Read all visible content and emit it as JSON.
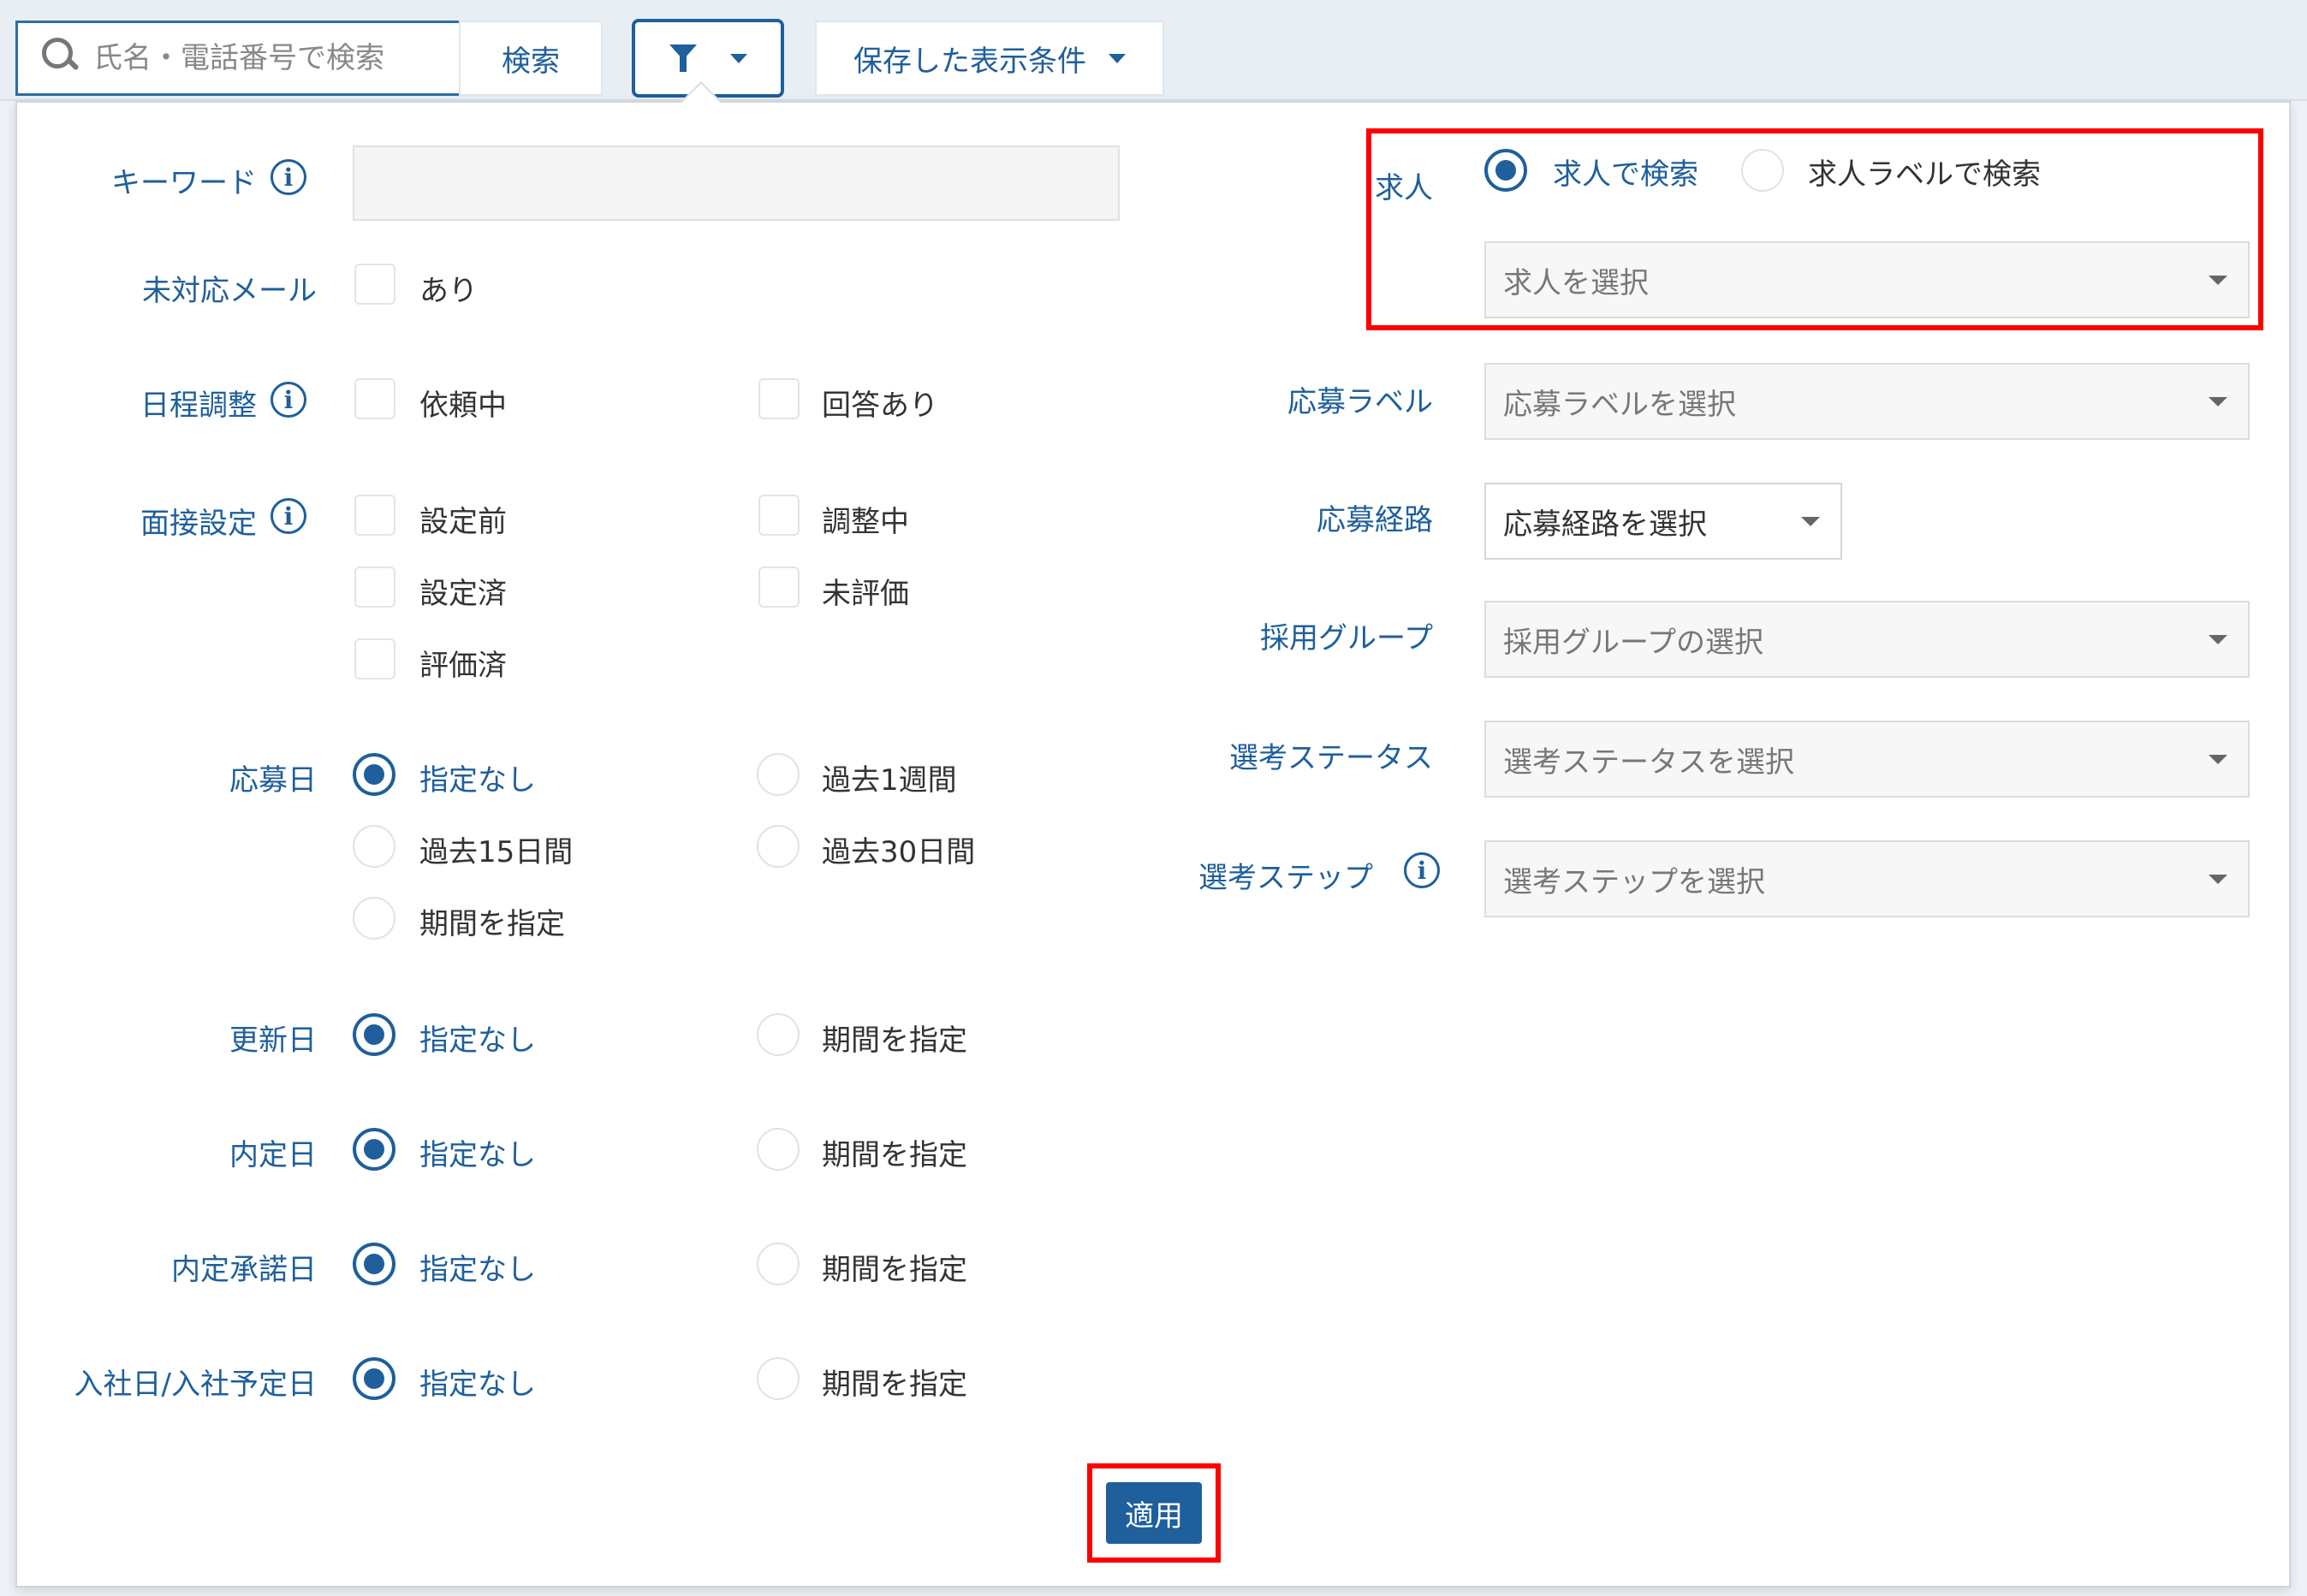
{
  "toolbar": {
    "search_placeholder": "氏名・電話番号で検索",
    "search_button": "検索",
    "saved_conditions": "保存した表示条件"
  },
  "filters": {
    "keyword": {
      "label": "キーワード",
      "value": ""
    },
    "unhandled_mail": {
      "label": "未対応メール",
      "option": "あり"
    },
    "schedule": {
      "label": "日程調整",
      "options": [
        "依頼中",
        "回答あり"
      ]
    },
    "interview": {
      "label": "面接設定",
      "options": [
        "設定前",
        "調整中",
        "設定済",
        "未評価",
        "評価済"
      ]
    },
    "applied_date": {
      "label": "応募日",
      "options": [
        "指定なし",
        "過去1週間",
        "過去15日間",
        "過去30日間",
        "期間を指定"
      ],
      "selected": "指定なし"
    },
    "updated_date": {
      "label": "更新日",
      "options": [
        "指定なし",
        "期間を指定"
      ],
      "selected": "指定なし"
    },
    "offer_date": {
      "label": "内定日",
      "options": [
        "指定なし",
        "期間を指定"
      ],
      "selected": "指定なし"
    },
    "offer_accept_date": {
      "label": "内定承諾日",
      "options": [
        "指定なし",
        "期間を指定"
      ],
      "selected": "指定なし"
    },
    "join_date": {
      "label": "入社日/入社予定日",
      "options": [
        "指定なし",
        "期間を指定"
      ],
      "selected": "指定なし"
    }
  },
  "right": {
    "job": {
      "label": "求人",
      "options": [
        "求人で検索",
        "求人ラベルで検索"
      ],
      "selected": "求人で検索",
      "placeholder": "求人を選択"
    },
    "apply_label": {
      "label": "応募ラベル",
      "placeholder": "応募ラベルを選択"
    },
    "apply_route": {
      "label": "応募経路",
      "placeholder": "応募経路を選択"
    },
    "hiring_group": {
      "label": "採用グループ",
      "placeholder": "採用グループの選択"
    },
    "selection_status": {
      "label": "選考ステータス",
      "placeholder": "選考ステータスを選択"
    },
    "selection_step": {
      "label": "選考ステップ",
      "placeholder": "選考ステップを選択"
    }
  },
  "apply_button": "適用",
  "colors": {
    "accent": "#1e5f9c",
    "highlight": "#ff0000"
  }
}
